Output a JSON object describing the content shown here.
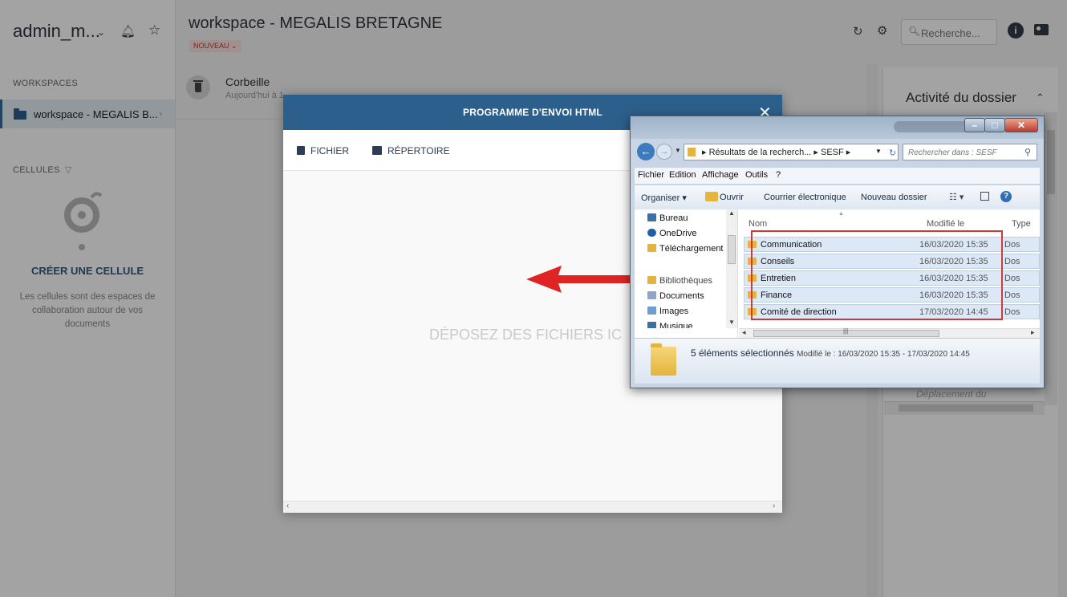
{
  "sidebar": {
    "user": "admin_m...",
    "workspaces_heading": "WORKSPACES",
    "workspace_item": "workspace - MEGALIS B...",
    "cells_heading": "CELLULES",
    "create_cell": "CRÉER UNE CELLULE",
    "cell_description": "Les cellules sont des espaces de collaboration autour de vos documents"
  },
  "header": {
    "title": "workspace - MEGALIS BRETAGNE",
    "new_badge": "NOUVEAU",
    "search_placeholder": "Recherche..."
  },
  "content": {
    "trash_title": "Corbeille",
    "trash_subtitle": "Aujourd'hui à 1"
  },
  "right_panel": {
    "title": "Activité du dossier",
    "faded_text": "Déplacement du"
  },
  "modal": {
    "title": "PROGRAMME D'ENVOI HTML",
    "file_button": "FICHIER",
    "folder_button": "RÉPERTOIRE",
    "drop_text": "DÉPOSEZ DES FICHIERS IC"
  },
  "explorer": {
    "address": "▸ Résultats de la recherch... ▸ SESF ▸",
    "search_placeholder": "Rechercher dans : SESF",
    "menu": [
      "Fichier",
      "Edition",
      "Affichage",
      "Outils",
      "?"
    ],
    "commands": {
      "organize": "Organiser",
      "open": "Ouvrir",
      "email": "Courrier électronique",
      "new_folder": "Nouveau dossier"
    },
    "nav_items": [
      "Bureau",
      "OneDrive",
      "Téléchargement",
      "Bibliothèques",
      "Documents",
      "Images",
      "Musique"
    ],
    "columns": [
      "Nom",
      "Modifié le",
      "Type"
    ],
    "rows": [
      {
        "name": "Communication",
        "date": "16/03/2020 15:35",
        "type": "Dossier"
      },
      {
        "name": "Conseils",
        "date": "16/03/2020 15:35",
        "type": "Dossier"
      },
      {
        "name": "Entretien",
        "date": "16/03/2020 15:35",
        "type": "Dossier"
      },
      {
        "name": "Finance",
        "date": "16/03/2020 15:35",
        "type": "Dossier"
      },
      {
        "name": "Comité de direction",
        "date": "17/03/2020 14:45",
        "type": "Dossier"
      }
    ],
    "details_main": "5 éléments sélectionnés",
    "details_sub": "Modifié le : 16/03/2020 15:35 - 17/03/2020 14:45"
  },
  "colors": {
    "primary": "#2d5f8c",
    "accent_red": "#d23a3a",
    "folder_yellow": "#e6b43c"
  }
}
